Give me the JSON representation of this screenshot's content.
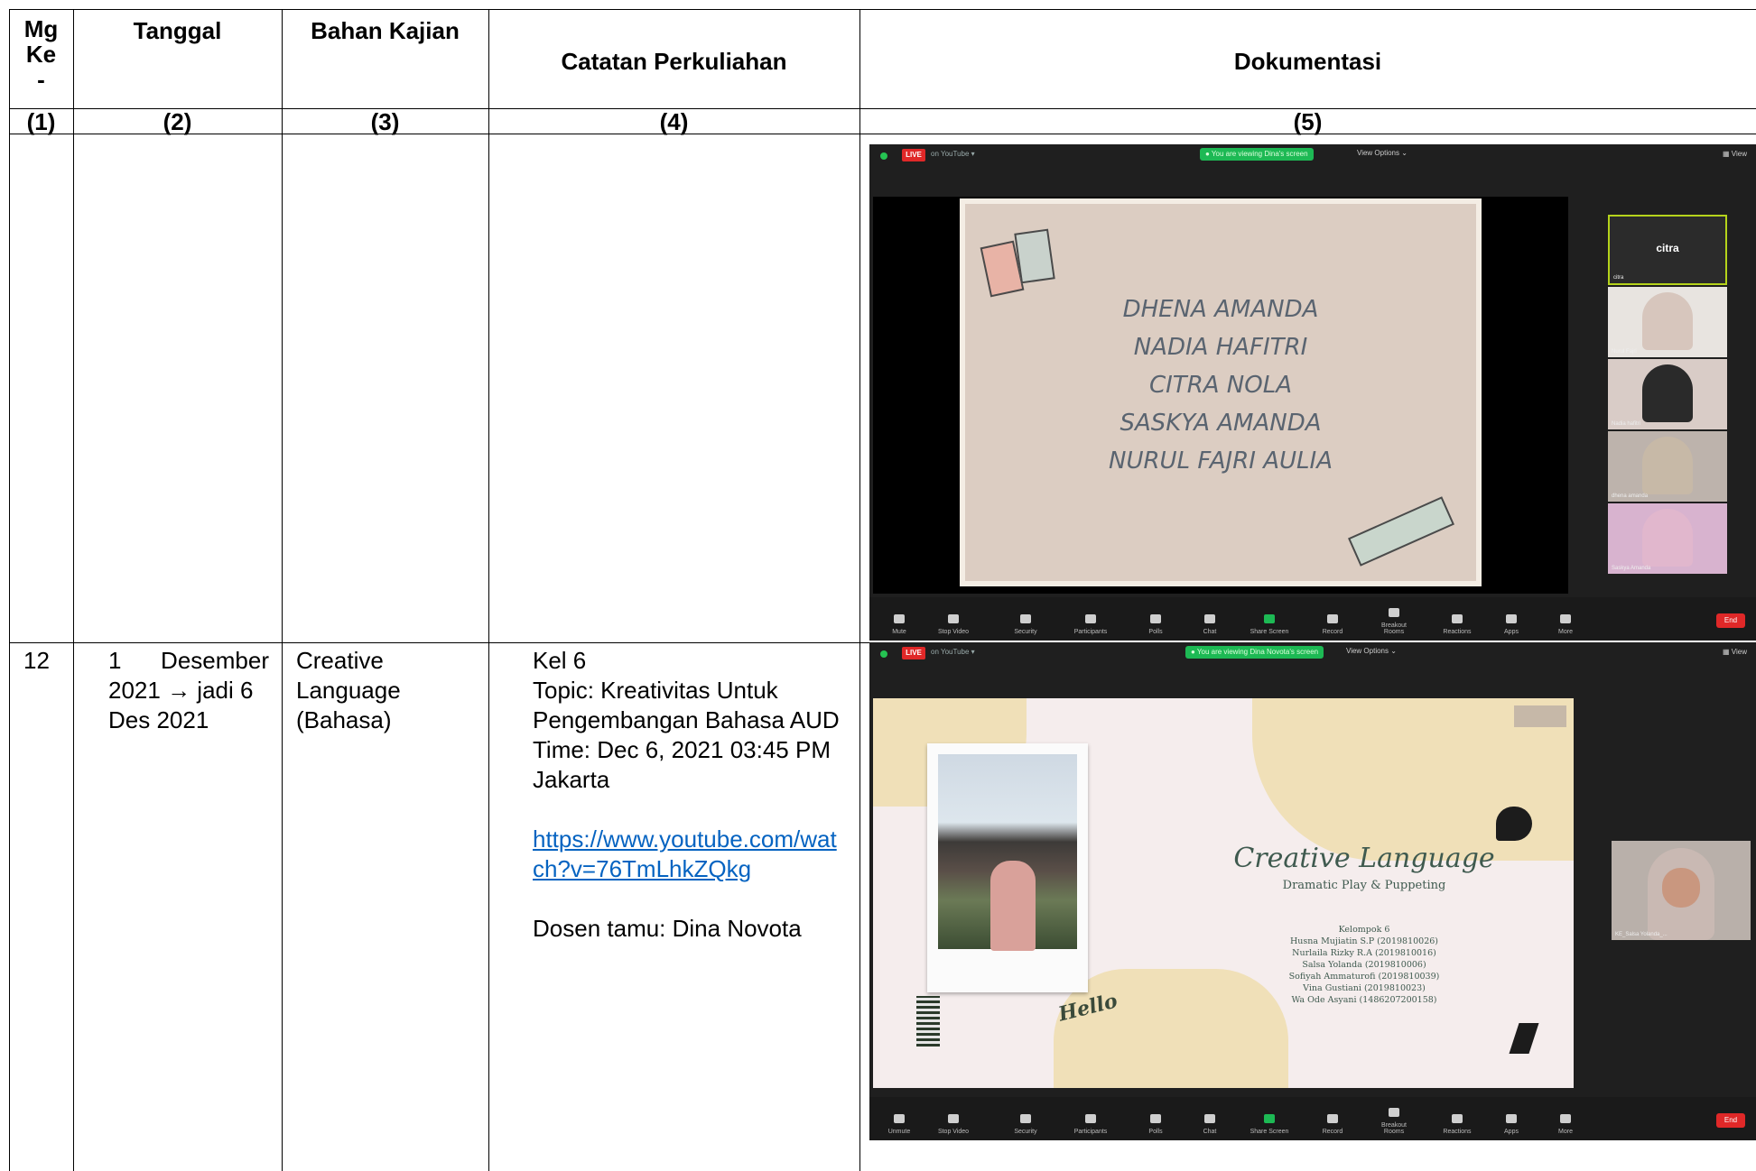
{
  "headers": {
    "col1": [
      "Mg",
      "Ke",
      "-"
    ],
    "col2": "Tanggal",
    "col3": "Bahan Kajian",
    "col4": "Catatan Perkuliahan",
    "col5": "Dokumentasi"
  },
  "numbers": [
    "(1)",
    "(2)",
    "(3)",
    "(4)",
    "(5)"
  ],
  "row12": {
    "no": "12",
    "tanggal": [
      "1 Desember",
      "2021 → jadi 6",
      "Des 2021"
    ],
    "bahan": [
      "Creative",
      "Language",
      "(Bahasa)"
    ],
    "catatan": {
      "kel": "Kel 6",
      "topic1": "Topic: Kreativitas Untuk",
      "topic2": "Pengembangan Bahasa AUD",
      "time1": "Time: Dec 6, 2021 03:45 PM",
      "time2": "Jakarta",
      "link1": "https://www.youtube.com/wat",
      "link2": "ch?v=76TmLhkZQkg",
      "dosen": "Dosen tamu: Dina Novota"
    }
  },
  "zoom1": {
    "live_badge": "LIVE",
    "youtube": "on YouTube ▾",
    "viewing": "● You are viewing Dina's screen",
    "view_options": "View Options ⌄",
    "view": "▦ View",
    "slide_names": [
      "DHENA AMANDA",
      "NADIA HAFITRI",
      "CITRA NOLA",
      "SASKYA AMANDA",
      "NURUL FAJRI AULIA"
    ],
    "thumb_name": "citra",
    "thumb_label": "citra",
    "thumb_labels": [
      "Nurul Fajri",
      "Nadia hafitri",
      "dhena amanda",
      "Saskya Amanda"
    ],
    "toolbar": [
      "Mute",
      "Stop Video",
      "Security",
      "Participants",
      "Polls",
      "Chat",
      "Share Screen",
      "Record",
      "Breakout Rooms",
      "Reactions",
      "Apps",
      "More"
    ],
    "end": "End"
  },
  "zoom2": {
    "live_badge": "LIVE",
    "youtube": "on YouTube ▾",
    "viewing": "● You are viewing Dina Novota's screen",
    "view_options": "View Options ⌄",
    "view": "▦ View",
    "title": "Creative Language",
    "subtitle": "Dramatic Play & Puppeting",
    "members": [
      "Kelompok 6",
      "Husna Mujiatin S.P (2019810026)",
      "Nurlaila Rizky R.A (2019810016)",
      "Salsa Yolanda (2019810006)",
      "Sofiyah Ammaturofi (2019810039)",
      "Vina Gustiani (2019810023)",
      "Wa Ode Asyani (1486207200158)"
    ],
    "hello": "Hello",
    "cam_label": "KE_Salsa Yolanda_...",
    "toolbar": [
      "Unmute",
      "Stop Video",
      "Security",
      "Participants",
      "Polls",
      "Chat",
      "Share Screen",
      "Record",
      "Breakout Rooms",
      "Reactions",
      "Apps",
      "More"
    ],
    "end": "End"
  }
}
